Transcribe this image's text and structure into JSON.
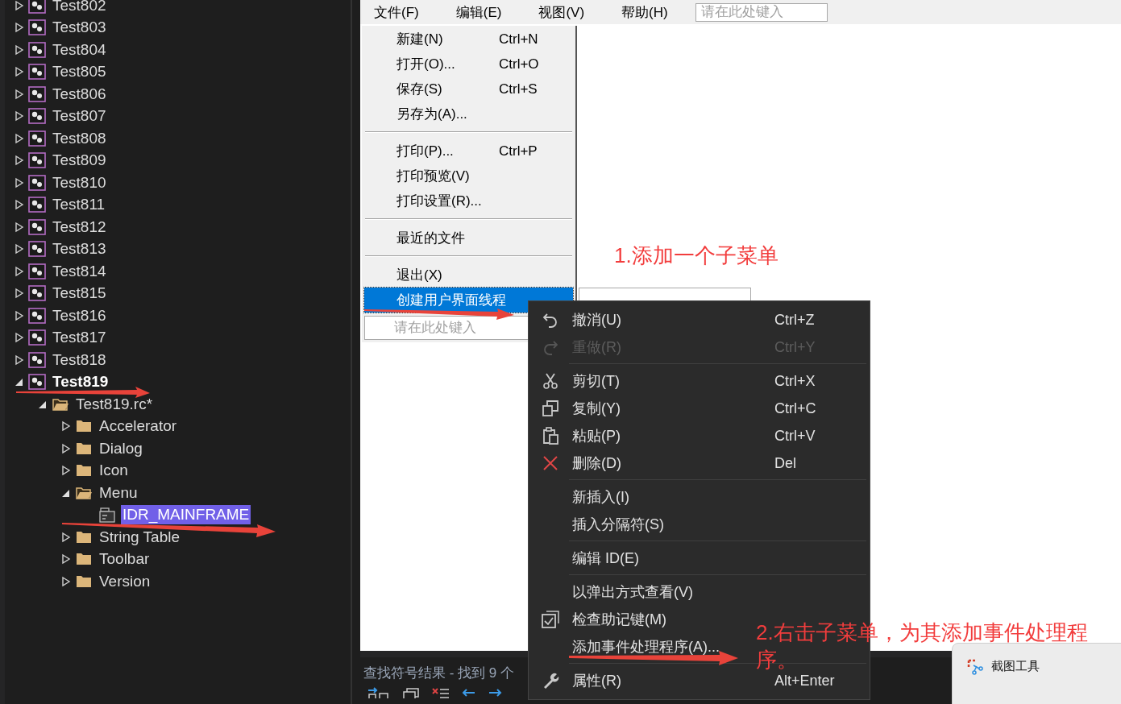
{
  "solution_tree": [
    {
      "label": "Test802",
      "kind": "project",
      "expanded": false,
      "selected": false,
      "startup": false
    },
    {
      "label": "Test803",
      "kind": "project",
      "expanded": false,
      "selected": false,
      "startup": false
    },
    {
      "label": "Test804",
      "kind": "project",
      "expanded": false,
      "selected": false,
      "startup": false
    },
    {
      "label": "Test805",
      "kind": "project",
      "expanded": false,
      "selected": false,
      "startup": false
    },
    {
      "label": "Test806",
      "kind": "project",
      "expanded": false,
      "selected": false,
      "startup": false
    },
    {
      "label": "Test807",
      "kind": "project",
      "expanded": false,
      "selected": false,
      "startup": false
    },
    {
      "label": "Test808",
      "kind": "project",
      "expanded": false,
      "selected": false,
      "startup": false
    },
    {
      "label": "Test809",
      "kind": "project",
      "expanded": false,
      "selected": false,
      "startup": false
    },
    {
      "label": "Test810",
      "kind": "project",
      "expanded": false,
      "selected": false,
      "startup": false
    },
    {
      "label": "Test811",
      "kind": "project",
      "expanded": false,
      "selected": false,
      "startup": false
    },
    {
      "label": "Test812",
      "kind": "project",
      "expanded": false,
      "selected": false,
      "startup": false
    },
    {
      "label": "Test813",
      "kind": "project",
      "expanded": false,
      "selected": false,
      "startup": false
    },
    {
      "label": "Test814",
      "kind": "project",
      "expanded": false,
      "selected": false,
      "startup": false
    },
    {
      "label": "Test815",
      "kind": "project",
      "expanded": false,
      "selected": false,
      "startup": false
    },
    {
      "label": "Test816",
      "kind": "project",
      "expanded": false,
      "selected": false,
      "startup": false
    },
    {
      "label": "Test817",
      "kind": "project",
      "expanded": false,
      "selected": false,
      "startup": false
    },
    {
      "label": "Test818",
      "kind": "project",
      "expanded": false,
      "selected": false,
      "startup": false
    },
    {
      "label": "Test819",
      "kind": "project",
      "expanded": true,
      "selected": false,
      "startup": true,
      "children": [
        {
          "label": "Test819.rc*",
          "kind": "rc",
          "expanded": true,
          "selected": false,
          "children": [
            {
              "label": "Accelerator",
              "kind": "folder",
              "expanded": false,
              "selected": false
            },
            {
              "label": "Dialog",
              "kind": "folder",
              "expanded": false,
              "selected": false
            },
            {
              "label": "Icon",
              "kind": "folder",
              "expanded": false,
              "selected": false
            },
            {
              "label": "Menu",
              "kind": "folder",
              "expanded": true,
              "selected": false,
              "children": [
                {
                  "label": "IDR_MAINFRAME",
                  "kind": "menu_resource",
                  "selected": true
                }
              ]
            },
            {
              "label": "String Table",
              "kind": "folder",
              "expanded": false,
              "selected": false
            },
            {
              "label": "Toolbar",
              "kind": "folder",
              "expanded": false,
              "selected": false
            },
            {
              "label": "Version",
              "kind": "folder",
              "expanded": false,
              "selected": false
            }
          ]
        }
      ]
    }
  ],
  "menu_bar": {
    "items": [
      "文件(F)",
      "编辑(E)",
      "视图(V)",
      "帮助(H)"
    ],
    "placeholder": "请在此处键入"
  },
  "file_menu": [
    {
      "kind": "item",
      "label": "新建(N)",
      "shortcut": "Ctrl+N",
      "selected": false
    },
    {
      "kind": "item",
      "label": "打开(O)...",
      "shortcut": "Ctrl+O",
      "selected": false
    },
    {
      "kind": "item",
      "label": "保存(S)",
      "shortcut": "Ctrl+S",
      "selected": false
    },
    {
      "kind": "item",
      "label": "另存为(A)...",
      "selected": false
    },
    {
      "kind": "separator"
    },
    {
      "kind": "item",
      "label": "打印(P)...",
      "shortcut": "Ctrl+P",
      "selected": false
    },
    {
      "kind": "item",
      "label": "打印预览(V)",
      "selected": false
    },
    {
      "kind": "item",
      "label": "打印设置(R)...",
      "selected": false
    },
    {
      "kind": "separator"
    },
    {
      "kind": "item",
      "label": "最近的文件",
      "selected": false
    },
    {
      "kind": "separator"
    },
    {
      "kind": "item",
      "label": "退出(X)",
      "selected": false
    },
    {
      "kind": "item",
      "label": "创建用户界面线程",
      "selected": true
    },
    {
      "kind": "field",
      "placeholder": "请在此处键入"
    }
  ],
  "context_menu": [
    {
      "kind": "item",
      "label": "撤消(U)",
      "shortcut": "Ctrl+Z",
      "disabled": false
    },
    {
      "kind": "item",
      "label": "重做(R)",
      "shortcut": "Ctrl+Y",
      "disabled": true
    },
    {
      "kind": "separator"
    },
    {
      "kind": "item",
      "label": "剪切(T)",
      "shortcut": "Ctrl+X",
      "disabled": false
    },
    {
      "kind": "item",
      "label": "复制(Y)",
      "shortcut": "Ctrl+C",
      "disabled": false
    },
    {
      "kind": "item",
      "label": "粘贴(P)",
      "shortcut": "Ctrl+V",
      "disabled": false
    },
    {
      "kind": "item",
      "label": "删除(D)",
      "shortcut": "Del",
      "disabled": false
    },
    {
      "kind": "separator"
    },
    {
      "kind": "item",
      "label": "新插入(I)",
      "disabled": false
    },
    {
      "kind": "item",
      "label": "插入分隔符(S)",
      "disabled": false
    },
    {
      "kind": "separator"
    },
    {
      "kind": "item",
      "label": "编辑 ID(E)",
      "disabled": false
    },
    {
      "kind": "separator"
    },
    {
      "kind": "item",
      "label": "以弹出方式查看(V)",
      "disabled": false
    },
    {
      "kind": "item",
      "label": "检查助记键(M)",
      "disabled": false
    },
    {
      "kind": "item",
      "label": "添加事件处理程序(A)...",
      "disabled": false
    },
    {
      "kind": "separator"
    },
    {
      "kind": "item",
      "label": "属性(R)",
      "shortcut": "Alt+Enter",
      "disabled": false
    }
  ],
  "annotations": [
    {
      "lines": [
        "1.添加一个子菜单"
      ]
    },
    {
      "lines": [
        "2.右击子菜单，为其添加事件处理程",
        "序。"
      ]
    }
  ],
  "results_panel": {
    "title": "查找符号结果 - 找到 9 个"
  },
  "notification": {
    "app": "截图工具"
  }
}
